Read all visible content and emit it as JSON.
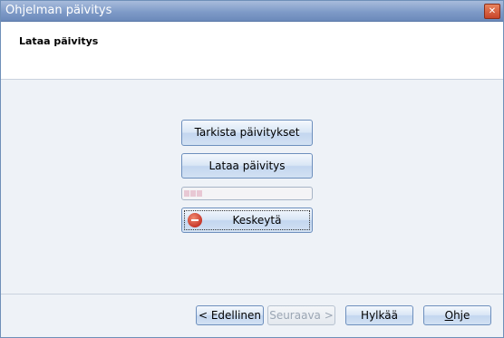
{
  "window": {
    "title": "Ohjelman päivitys",
    "close_glyph": "✕"
  },
  "header": {
    "title": "Lataa päivitys"
  },
  "main": {
    "check_updates_label": "Tarkista päivitykset",
    "download_update_label": "Lataa päivitys",
    "progress_fraction": 0.15,
    "abort_label": "Keskeytä"
  },
  "footer": {
    "previous_label": "< Edellinen",
    "next_label": "Seuraava >",
    "cancel_label": "Hylkää",
    "help_label_first": "O",
    "help_label_rest": "hje"
  },
  "colors": {
    "titlebar": "#7f9bc8",
    "accent_border": "#6d8fbd",
    "background": "#eef2f7",
    "progress_fill": "#e8c8d4"
  },
  "icons": {
    "close": "close-icon",
    "abort": "stop-icon"
  }
}
